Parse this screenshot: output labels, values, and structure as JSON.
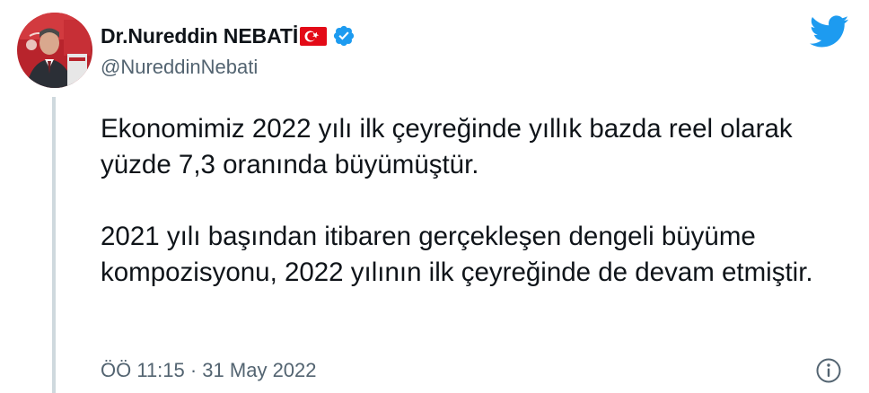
{
  "author": {
    "display_name": "Dr.Nureddin NEBATİ",
    "handle": "@NureddinNebati",
    "flag_icon": "turkey-flag-icon",
    "verified_icon": "verified-badge-icon",
    "avatar": "profile-photo"
  },
  "tweet": {
    "paragraphs": [
      "Ekonomimiz 2022 yılı ilk çeyreğinde yıllık bazda reel olarak yüzde 7,3 oranında büyümüştür.",
      "2021 yılı başından itibaren gerçekleşen dengeli büyüme kompozisyonu, 2022 yılının ilk çeyreğinde de devam etmiştir."
    ],
    "timestamp": "ÖÖ 11:15 · 31 May 2022"
  },
  "icons": {
    "twitter_logo": "twitter-bird-icon",
    "info": "info-icon"
  },
  "colors": {
    "twitter_blue": "#1d9bf0",
    "verified_blue": "#1d9bf0",
    "flag_red": "#e30a17",
    "secondary_text": "#536471",
    "primary_text": "#0f1419",
    "thread_line": "#cfd9de"
  }
}
